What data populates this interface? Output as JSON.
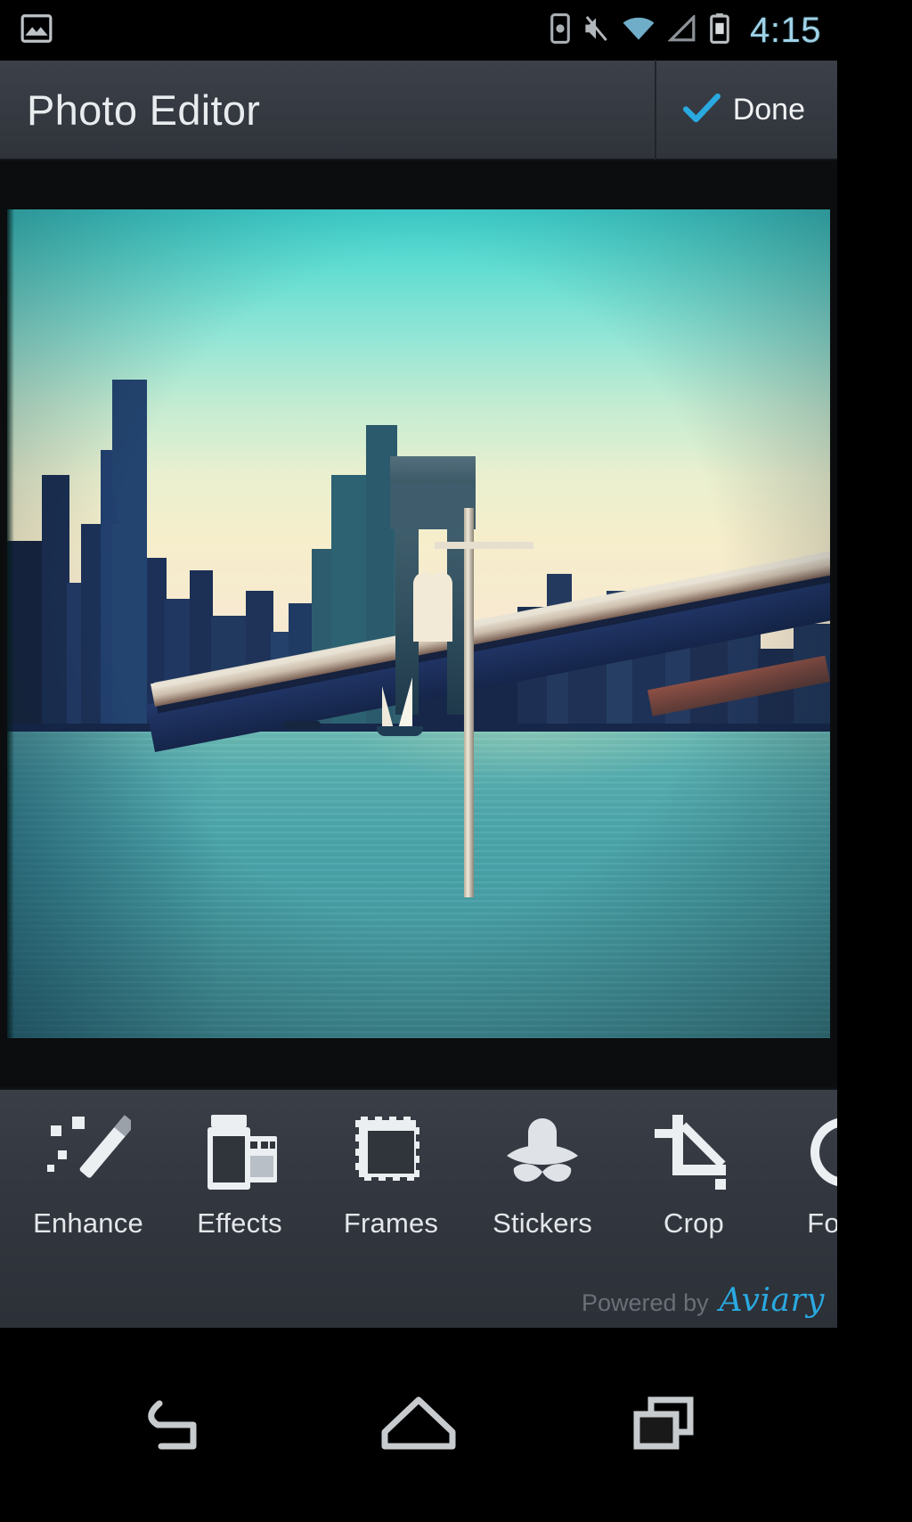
{
  "status_bar": {
    "clock": "4:15",
    "clock_color": "#9fd3e8",
    "icons": [
      {
        "name": "gallery-icon",
        "position": "left"
      },
      {
        "name": "sim-card-icon",
        "position": "right"
      },
      {
        "name": "vibrate-icon",
        "position": "right"
      },
      {
        "name": "wifi-icon",
        "position": "right",
        "color": "#6fb6d6"
      },
      {
        "name": "cell-signal-icon",
        "position": "right"
      },
      {
        "name": "battery-icon",
        "position": "right"
      }
    ]
  },
  "action_bar": {
    "title": "Photo Editor",
    "done_label": "Done",
    "done_check_color": "#2aa9e0",
    "background": "#363a42"
  },
  "photo": {
    "subject": "Brooklyn Bridge and Manhattan skyline over the East River with a sailboat",
    "sky_top_color": "#3ed2cf",
    "sky_bottom_color": "#f6eecb",
    "water_top_color": "#8cc7b8",
    "water_bottom_color": "#418f96",
    "skyline_color": "#1f3a63"
  },
  "tool_tray": {
    "tools": [
      {
        "label": "Enhance",
        "icon": "magic-wand-icon"
      },
      {
        "label": "Effects",
        "icon": "film-roll-icon"
      },
      {
        "label": "Frames",
        "icon": "photo-frame-icon"
      },
      {
        "label": "Stickers",
        "icon": "hat-mustache-icon"
      },
      {
        "label": "Crop",
        "icon": "crop-icon"
      },
      {
        "label": "Focus",
        "icon": "focus-target-icon"
      }
    ],
    "powered_by_text": "Powered by",
    "brand": "Aviary",
    "brand_color": "#2aa9e0"
  },
  "nav_bar": {
    "buttons": [
      {
        "label": "Back",
        "icon": "back-arrow-icon"
      },
      {
        "label": "Home",
        "icon": "home-icon"
      },
      {
        "label": "Recents",
        "icon": "recents-icon"
      }
    ]
  }
}
